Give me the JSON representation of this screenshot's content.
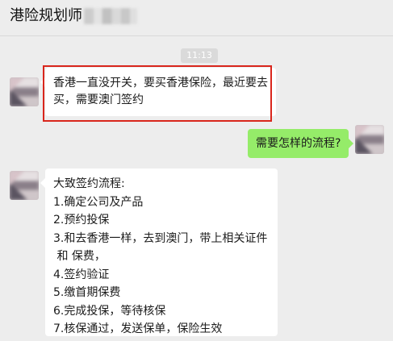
{
  "header": {
    "title": "港险规划师"
  },
  "chat": {
    "timestamp": "11:13",
    "messages": [
      {
        "side": "left",
        "text": "香港一直没开关，要买香港保险，最近要去买，需要澳门签约"
      },
      {
        "side": "right",
        "text": "需要怎样的流程?"
      },
      {
        "side": "left",
        "lines": [
          "大致签约流程:",
          "1.确定公司及产品",
          "2.预约投保",
          "3.和去香港一样，去到澳门，带上相关证件",
          " 和 保费，",
          "4.签约验证",
          "5.缴首期保费",
          "6.完成投保，等待核保",
          "7.核保通过，发送保单，保险生效"
        ]
      }
    ]
  },
  "colors": {
    "background": "#ededed",
    "sent_bubble": "#95ec69",
    "received_bubble": "#ffffff",
    "highlight": "#d9261c"
  }
}
